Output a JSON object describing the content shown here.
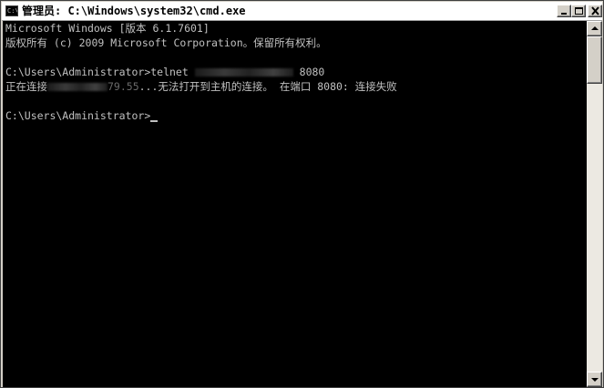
{
  "window": {
    "title": "管理员: C:\\Windows\\system32\\cmd.exe",
    "icon_label": "C:\\",
    "buttons": {
      "minimize_icon": "minimize-icon",
      "maximize_icon": "maximize-icon",
      "close_icon": "close-icon"
    }
  },
  "console": {
    "lines": [
      "Microsoft Windows [版本 6.1.7601]",
      "版权所有 (c) 2009 Microsoft Corporation。保留所有权利。",
      "",
      "C:\\Users\\Administrator>telnet ",
      "正在连接",
      "",
      "C:\\Users\\Administrator>"
    ],
    "telnet_port": " 8080",
    "connect_partial": "79.55",
    "connect_tail": "...无法打开到主机的连接。 在端口 8080: 连接失败"
  },
  "colors": {
    "console_bg": "#000000",
    "console_text": "#c0c0c0",
    "chrome": "#d4d0c8"
  }
}
